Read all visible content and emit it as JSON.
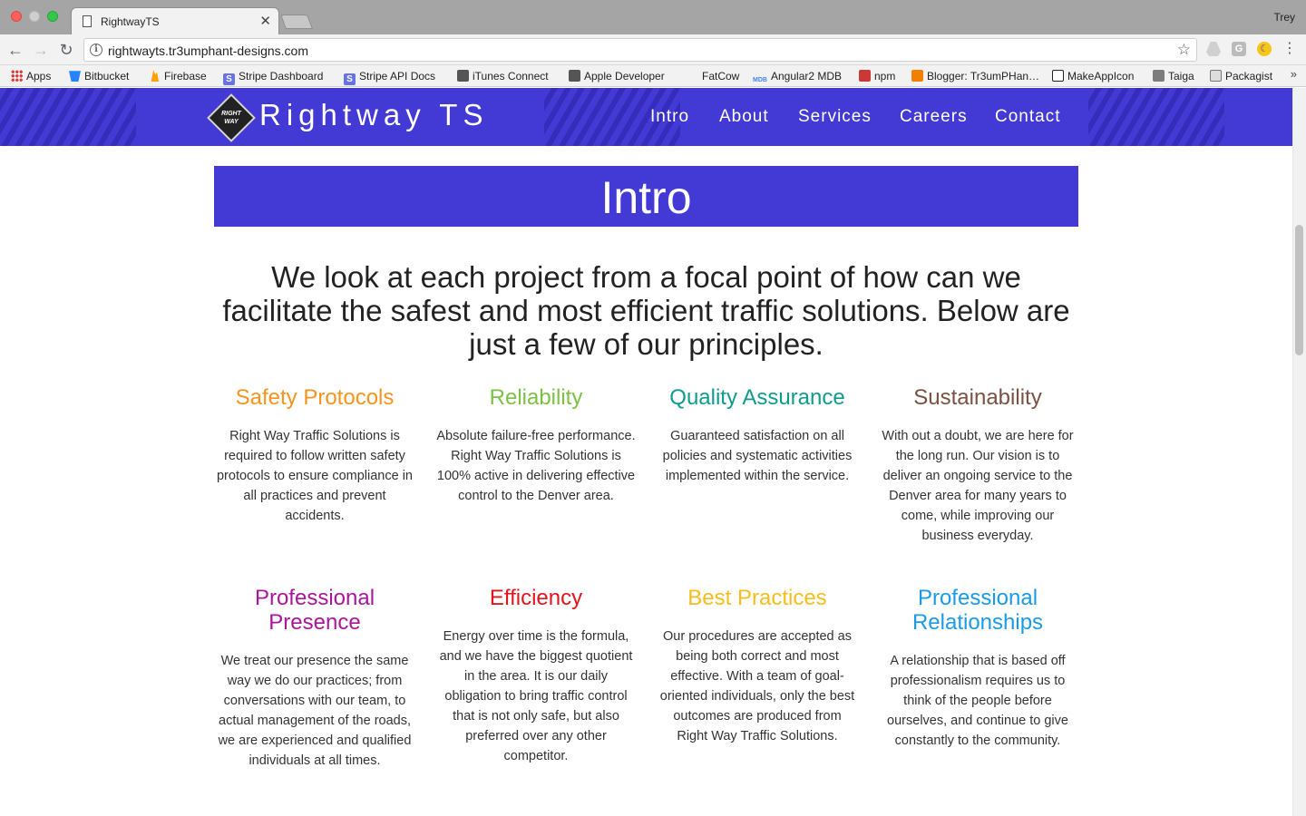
{
  "browser": {
    "tab_title": "RightwayTS",
    "user": "Trey",
    "url": "rightwayts.tr3umphant-designs.com",
    "bookmarks": [
      {
        "label": "Apps",
        "icon": "apps-grid-icon"
      },
      {
        "label": "Bitbucket",
        "icon": "bitbucket-icon"
      },
      {
        "label": "Firebase",
        "icon": "firebase-icon"
      },
      {
        "label": "Stripe Dashboard",
        "icon": "stripe-icon"
      },
      {
        "label": "Stripe API Docs",
        "icon": "stripe-icon"
      },
      {
        "label": "iTunes Connect",
        "icon": "apple-icon"
      },
      {
        "label": "Apple Developer",
        "icon": "apple-icon"
      },
      {
        "label": "FatCow",
        "icon": "none"
      },
      {
        "label": "Angular2 MDB",
        "icon": "mdb-icon"
      },
      {
        "label": "npm",
        "icon": "npm-icon"
      },
      {
        "label": "Blogger: Tr3umPHan…",
        "icon": "blogger-icon"
      },
      {
        "label": "MakeAppIcon",
        "icon": "makeappicon-icon"
      },
      {
        "label": "Taiga",
        "icon": "taiga-icon"
      },
      {
        "label": "Packagist",
        "icon": "packagist-icon"
      }
    ],
    "more": "»"
  },
  "site": {
    "logo_text": "RIGHT WAY",
    "brand": "Rightway TS",
    "nav": [
      "Intro",
      "About",
      "Services",
      "Careers",
      "Contact"
    ],
    "colors": {
      "primary": "#4339d4"
    },
    "intro_title": "Intro",
    "lead": "We look at each project from a focal point of how can we facilitate the safest and most efficient traffic solutions. Below are just a few of our principles.",
    "principles": [
      {
        "title": "Safety Protocols",
        "color": "#f7941d",
        "text": "Right Way Traffic Solutions is required to follow written safety protocols to ensure compliance in all practices and prevent accidents."
      },
      {
        "title": "Reliability",
        "color": "#7cc142",
        "text": "Absolute failure-free performance. Right Way Traffic Solutions is 100% active in delivering effective control to the Denver area."
      },
      {
        "title": "Quality Assurance",
        "color": "#0f9b8e",
        "text": "Guaranteed satisfaction on all policies and systematic activities implemented within the service."
      },
      {
        "title": "Sustainability",
        "color": "#7b5141",
        "text": "With out a doubt, we are here for the long run. Our vision is to deliver an ongoing service to the Denver area for many years to come, while improving our business everyday."
      },
      {
        "title": "Professional Presence",
        "color": "#a9169c",
        "text": "We treat our presence the same way we do our practices; from conversations with our team, to actual management of the roads, we are experienced and qualified individuals at all times."
      },
      {
        "title": "Efficiency",
        "color": "#e3141b",
        "text": "Energy over time is the formula, and we have the biggest quotient in the area. It is our daily obligation to bring traffic control that is not only safe, but also preferred over any other competitor."
      },
      {
        "title": "Best Practices",
        "color": "#f7bc1d",
        "text": "Our procedures are accepted as being both correct and most effective. With a team of goal-oriented individuals, only the best outcomes are produced from Right Way Traffic Solutions."
      },
      {
        "title": "Professional Relationships",
        "color": "#1a9be8",
        "text": "A relationship that is based off professionalism requires us to think of the people before ourselves, and continue to give constantly to the community."
      }
    ]
  }
}
